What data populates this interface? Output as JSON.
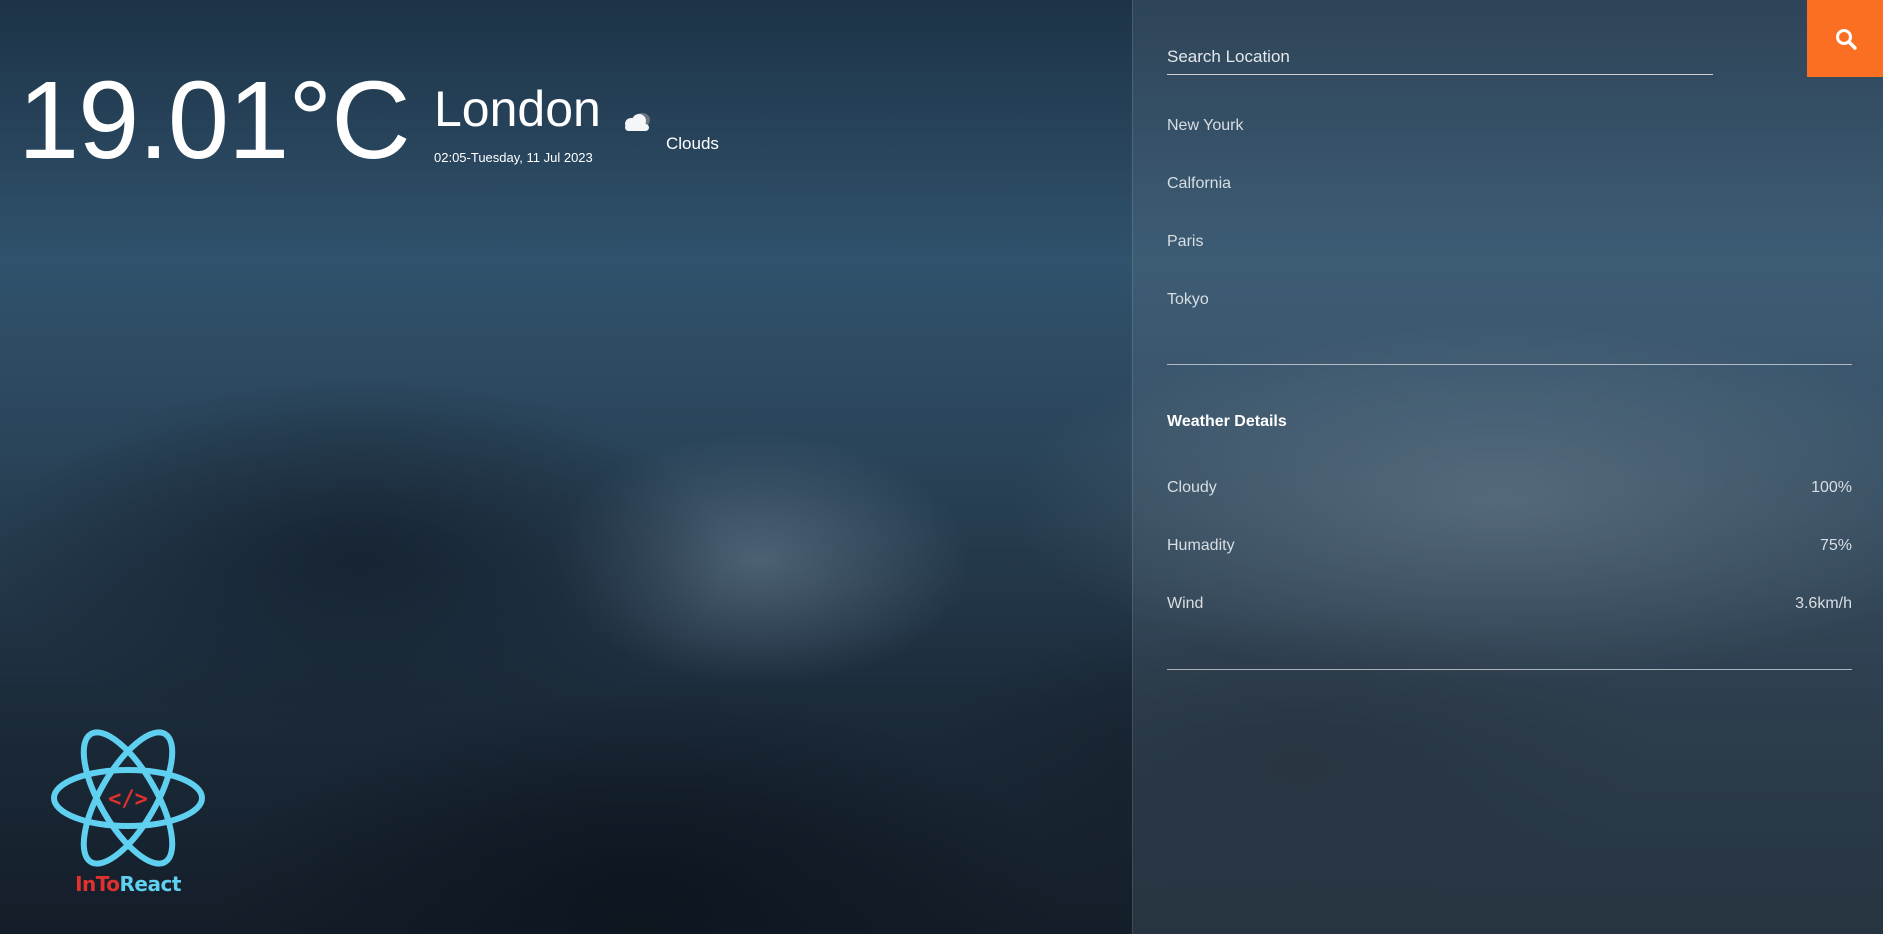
{
  "current": {
    "temperature": "19.01°C",
    "city": "London",
    "datetime": "02:05-Tuesday, 11 Jul 2023",
    "condition": "Clouds",
    "condition_icon": "cloud-icon"
  },
  "logo": {
    "text_part1": "InTo",
    "text_part2": "React",
    "colors": {
      "red": "#e0312e",
      "blue": "#5fd0f0"
    }
  },
  "search": {
    "placeholder": "Search Location",
    "value": "",
    "button_icon": "search-icon",
    "button_color": "#fb6f22"
  },
  "locations": [
    "New Yourk",
    "Calfornia",
    "Paris",
    "Tokyo"
  ],
  "details": {
    "title": "Weather Details",
    "rows": [
      {
        "label": "Cloudy",
        "value": "100%"
      },
      {
        "label": "Humadity",
        "value": "75%"
      },
      {
        "label": "Wind",
        "value": "3.6km/h"
      }
    ]
  }
}
